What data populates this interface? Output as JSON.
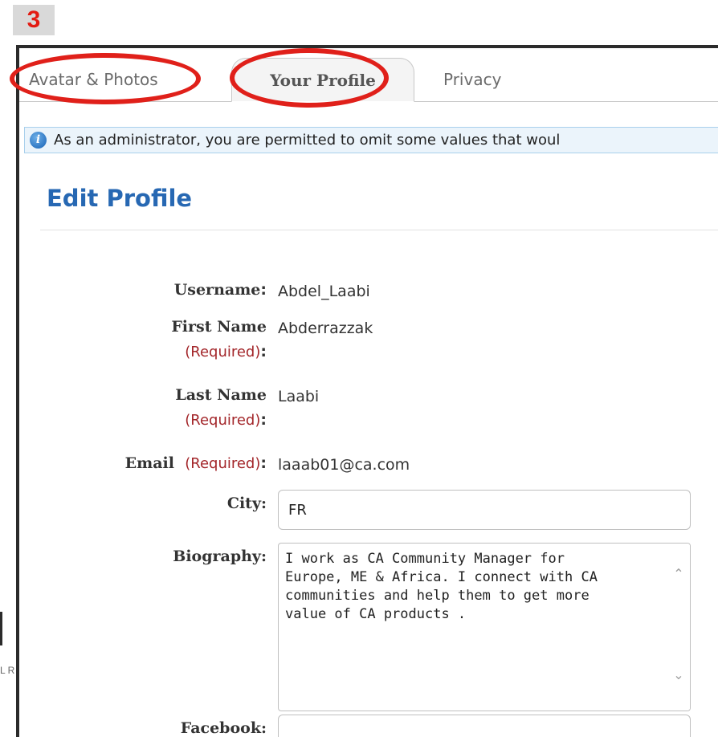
{
  "step_badge": "3",
  "edge_text": "L R",
  "tabs": [
    {
      "label": "Avatar & Photos",
      "active": false
    },
    {
      "label": "Your Profile",
      "active": true
    },
    {
      "label": "Privacy",
      "active": false
    }
  ],
  "info_bar": {
    "icon": "info-icon",
    "text": "As an administrator, you are permitted to omit some values that woul"
  },
  "page_title": "Edit Profile",
  "form": {
    "username": {
      "label": "Username",
      "value": "Abdel_Laabi"
    },
    "first_name": {
      "label": "First Name",
      "required": "(Required)",
      "value": "Abderrazzak"
    },
    "last_name": {
      "label": "Last Name",
      "required": "(Required)",
      "value": "Laabi"
    },
    "email": {
      "label": "Email",
      "required": "(Required)",
      "value": "laaab01@ca.com"
    },
    "city": {
      "label": "City:",
      "value": "FR"
    },
    "biography": {
      "label": "Biography:",
      "value": "I work as CA Community Manager for\nEurope, ME & Africa. I connect with CA\ncommunities and help them to get more\nvalue of CA products ."
    },
    "facebook": {
      "label": "Facebook:",
      "value": ""
    }
  },
  "colors": {
    "annotation": "#e0201a",
    "title": "#2768b3",
    "required": "#a3262a"
  }
}
